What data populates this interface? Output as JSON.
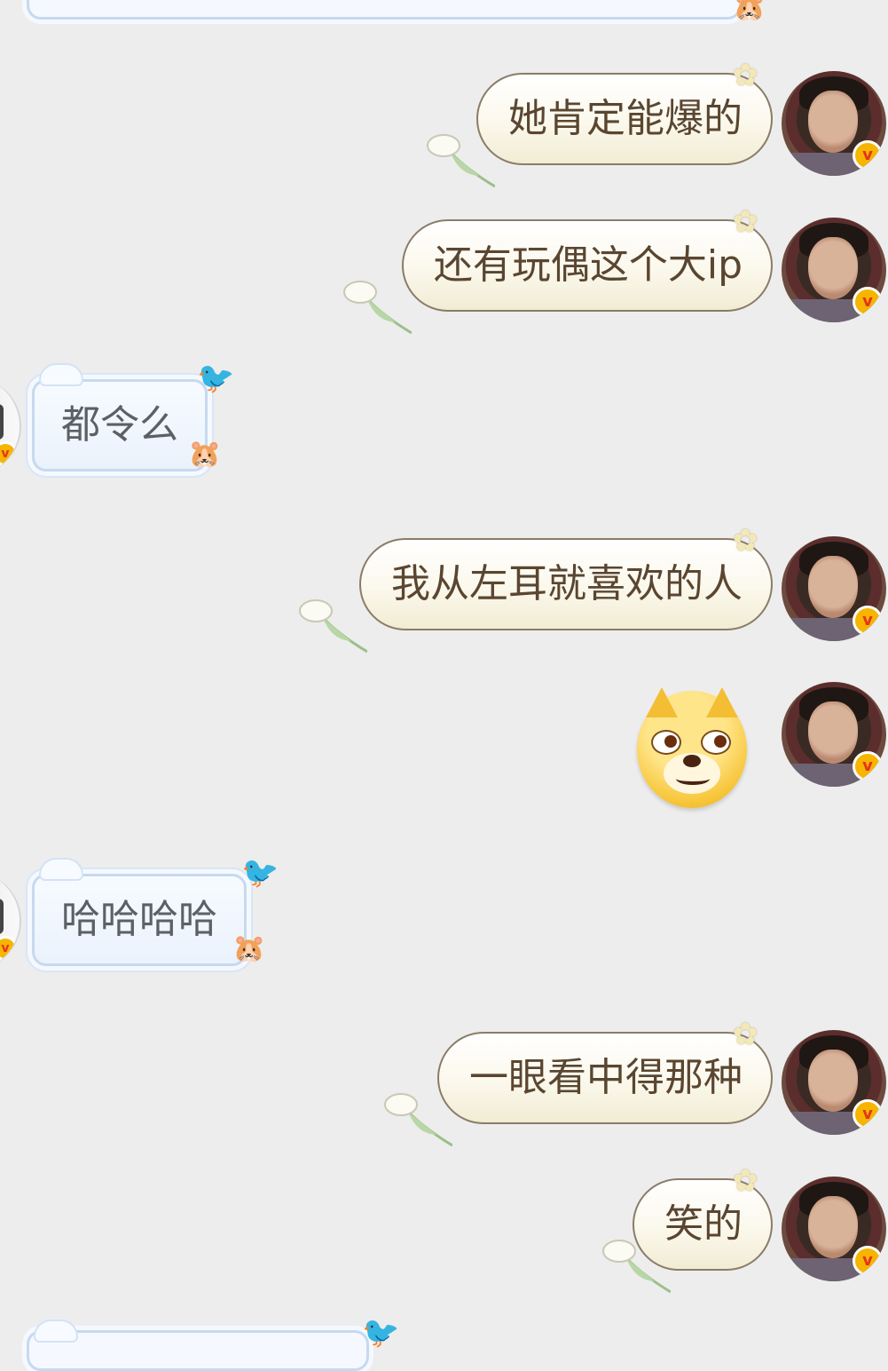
{
  "chat": {
    "messages": [
      {
        "side": "right",
        "text": "她肯定能爆的"
      },
      {
        "side": "right",
        "text": "还有玩偶这个大ip"
      },
      {
        "side": "left",
        "text": "都令么"
      },
      {
        "side": "right",
        "text": "我从左耳就喜欢的人"
      },
      {
        "side": "right",
        "type": "sticker",
        "sticker": "doge-emoji"
      },
      {
        "side": "left",
        "text": "哈哈哈哈"
      },
      {
        "side": "right",
        "text": "一眼看中得那种"
      },
      {
        "side": "right",
        "text": "笑的"
      }
    ]
  },
  "badge": {
    "glyph": "v",
    "color": "#f6b500"
  },
  "icons": {
    "flower": "✿",
    "bird": "🐦",
    "hamster": "🐹"
  }
}
